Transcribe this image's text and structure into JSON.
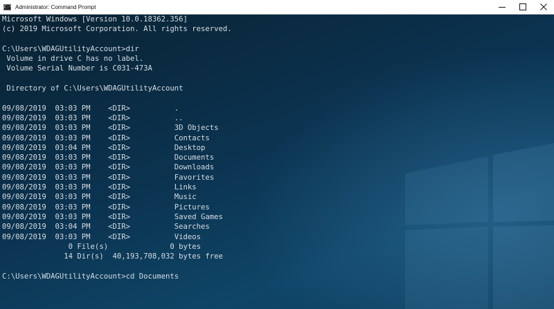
{
  "window": {
    "title": "Administrator: Command Prompt",
    "icon_text": "C:\\",
    "controls": [
      "minimize-icon",
      "maximize-icon",
      "close-icon"
    ]
  },
  "console": {
    "lines": [
      "Microsoft Windows [Version 10.0.18362.356]",
      "(c) 2019 Microsoft Corporation. All rights reserved.",
      "",
      "C:\\Users\\WDAGUtilityAccount>dir",
      " Volume in drive C has no label.",
      " Volume Serial Number is C031-473A",
      "",
      " Directory of C:\\Users\\WDAGUtilityAccount",
      "",
      "09/08/2019  03:03 PM    <DIR>          .",
      "09/08/2019  03:03 PM    <DIR>          ..",
      "09/08/2019  03:03 PM    <DIR>          3D Objects",
      "09/08/2019  03:03 PM    <DIR>          Contacts",
      "09/08/2019  03:04 PM    <DIR>          Desktop",
      "09/08/2019  03:03 PM    <DIR>          Documents",
      "09/08/2019  03:03 PM    <DIR>          Downloads",
      "09/08/2019  03:03 PM    <DIR>          Favorites",
      "09/08/2019  03:03 PM    <DIR>          Links",
      "09/08/2019  03:03 PM    <DIR>          Music",
      "09/08/2019  03:03 PM    <DIR>          Pictures",
      "09/08/2019  03:03 PM    <DIR>          Saved Games",
      "09/08/2019  03:04 PM    <DIR>          Searches",
      "09/08/2019  03:03 PM    <DIR>          Videos",
      "               0 File(s)              0 bytes",
      "              14 Dir(s)  40,193,708,032 bytes free",
      "",
      "C:\\Users\\WDAGUtilityAccount>cd Documents"
    ]
  },
  "colors": {
    "console_text": "#d6dde3",
    "console_bg": "#0b3552",
    "titlebar_bg": "#ffffff"
  }
}
